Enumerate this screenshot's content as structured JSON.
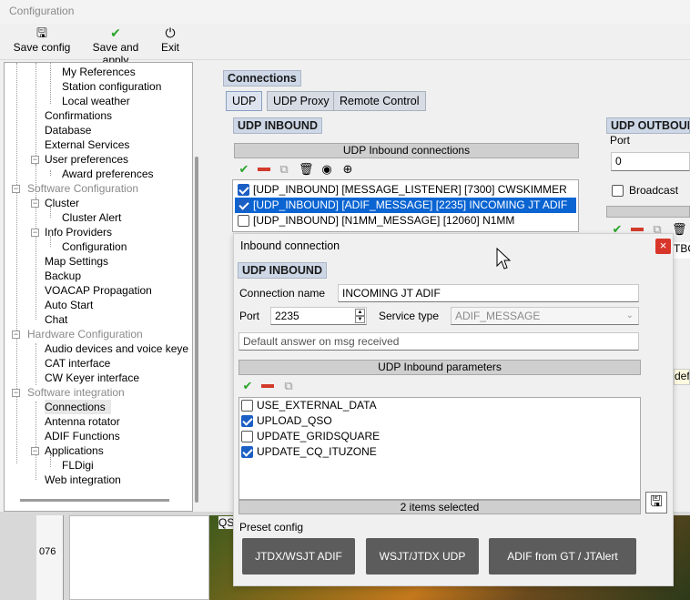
{
  "window": {
    "title": "Configuration"
  },
  "toolbar": {
    "save_config": "Save config",
    "save_and_apply": "Save and apply",
    "exit": "Exit"
  },
  "tree": {
    "items": [
      {
        "label": "My References"
      },
      {
        "label": "Station configuration"
      },
      {
        "label": "Local weather"
      },
      {
        "label": "Confirmations"
      },
      {
        "label": "Database"
      },
      {
        "label": "External Services"
      },
      {
        "label": "User preferences"
      },
      {
        "label": "Award preferences"
      },
      {
        "label": "Software Configuration"
      },
      {
        "label": "Cluster"
      },
      {
        "label": "Cluster Alert"
      },
      {
        "label": "Info Providers"
      },
      {
        "label": "Configuration"
      },
      {
        "label": "Map Settings"
      },
      {
        "label": "Backup"
      },
      {
        "label": "VOACAP Propagation"
      },
      {
        "label": "Auto Start"
      },
      {
        "label": "Chat"
      },
      {
        "label": "Hardware Configuration"
      },
      {
        "label": "Audio devices and voice keye"
      },
      {
        "label": "CAT interface"
      },
      {
        "label": "CW Keyer interface"
      },
      {
        "label": "Software integration"
      },
      {
        "label": "Connections"
      },
      {
        "label": "Antenna rotator"
      },
      {
        "label": "ADIF Functions"
      },
      {
        "label": "Applications"
      },
      {
        "label": "FLDigi"
      },
      {
        "label": "Web integration"
      }
    ]
  },
  "main": {
    "connections_label": "Connections",
    "tabs": [
      {
        "label": "UDP"
      },
      {
        "label": "UDP Proxy"
      },
      {
        "label": "Remote Control"
      }
    ],
    "udp_inbound_label": "UDP INBOUND",
    "inbound_grid_header": "UDP Inbound connections",
    "inbound_rows": [
      {
        "text": "[UDP_INBOUND] [MESSAGE_LISTENER] [7300] CWSKIMMER",
        "checked": true
      },
      {
        "text": "[UDP_INBOUND] [ADIF_MESSAGE] [2235] INCOMING JT ADIF",
        "checked": true
      },
      {
        "text": "[UDP_INBOUND] [N1MM_MESSAGE] [12060] N1MM",
        "checked": false
      }
    ],
    "udp_outbound_label": "UDP OUTBOUN",
    "outbound_port_label": "Port",
    "outbound_port_value": "0",
    "broadcast_label": "Broadcast",
    "outbound_list_partial": "TBC",
    "right_partial_text": "defa"
  },
  "dialog": {
    "title": "Inbound connection",
    "section_label": "UDP INBOUND",
    "connection_name_label": "Connection name",
    "connection_name_value": "INCOMING JT ADIF",
    "port_label": "Port",
    "port_value": "2235",
    "service_type_label": "Service type",
    "service_type_value": "ADIF_MESSAGE",
    "default_answer_placeholder": "Default answer on msg received",
    "params_header": "UDP Inbound parameters",
    "params": [
      {
        "label": "USE_EXTERNAL_DATA",
        "checked": false
      },
      {
        "label": "UPLOAD_QSO",
        "checked": true
      },
      {
        "label": "UPDATE_GRIDSQUARE",
        "checked": false
      },
      {
        "label": "UPDATE_CQ_ITUZONE",
        "checked": true
      }
    ],
    "params_status": "2 items selected",
    "preset_label": "Preset config",
    "presets": [
      {
        "label": "JTDX/WSJT ADIF"
      },
      {
        "label": "WSJT/JTDX UDP"
      },
      {
        "label": "ADIF from GT / JTAlert"
      }
    ]
  },
  "background": {
    "qs_partial": "QS",
    "ruler_value": "076"
  }
}
